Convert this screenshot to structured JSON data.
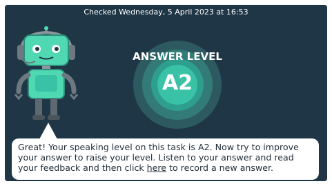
{
  "header": {
    "checked_text": "Checked Wednesday, 5 April 2023 at 16:53"
  },
  "result": {
    "title": "ANSWER LEVEL",
    "level": "A2"
  },
  "feedback": {
    "text_before_link": "Great! Your speaking level on this task is A2. Now try to improve your answer to raise your level. Listen to your answer and read your feedback and then click ",
    "link_text": "here",
    "text_after_link": " to record a new answer."
  },
  "colors": {
    "panel_background": "#1f3646",
    "accent": "#39c2a6",
    "robot_screen": "#4fd8b2"
  },
  "icons": {
    "robot": "robot-mascot-icon"
  }
}
